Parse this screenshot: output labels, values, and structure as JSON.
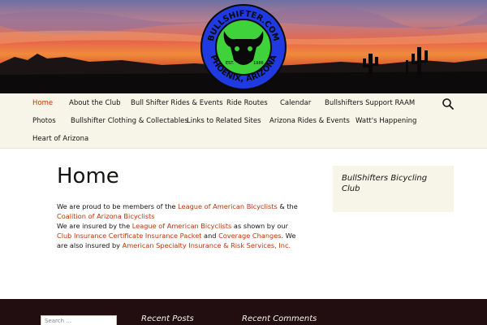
{
  "logo": {
    "text_top": "BULLSHIFTER.COM",
    "text_bottom": "PHOENIX, ARIZONA",
    "est_label": "EST.",
    "est_year": "1986",
    "colors": {
      "ring": "#1e3ae0",
      "center": "#3fd23a"
    }
  },
  "nav": {
    "row1": [
      {
        "label": "Home",
        "active": true
      },
      {
        "label": "About the Club"
      },
      {
        "label": "Bull Shifter Rides & Events"
      },
      {
        "label": "Ride Routes"
      },
      {
        "label": "Calendar"
      },
      {
        "label": "Bullshifters Support RAAM"
      }
    ],
    "row2": [
      {
        "label": "Photos"
      },
      {
        "label": "Bullshifter Clothing & Collectables"
      },
      {
        "label": "Links to Related Sites"
      },
      {
        "label": "Arizona Rides & Events"
      },
      {
        "label": "Watt's Happening"
      }
    ],
    "row3": [
      {
        "label": "Heart of Arizona"
      }
    ],
    "search_icon": "search-icon"
  },
  "main": {
    "title": "Home",
    "p1_a": "We are proud to be members of the ",
    "p1_link1": "League of American Bicyclists",
    "p1_b": " & the ",
    "p1_link2": "Coalition of Arizona Bicyclists",
    "p2_a": "We are insured by the ",
    "p2_link1": "League of American Bicyclists",
    "p2_b": " as shown by our ",
    "p2_link2": "Club Insurance Certificate Insurance Packet",
    "p2_c": " and ",
    "p2_link3": "Coverage Changes",
    "p2_d": ".  We are also insured by ",
    "p2_link4": "American Specialty Insurance & Risk Services, Inc.",
    "p2_e": ""
  },
  "sidebar": {
    "widget_title": "BullShifters Bicycling Club"
  },
  "footer": {
    "search_placeholder": "Search …",
    "recent_posts": "Recent Posts",
    "recent_comments": "Recent Comments"
  },
  "colors": {
    "accent": "#bc360a",
    "nav_bg": "#f7f5e7",
    "footer_bg": "#220e10"
  }
}
